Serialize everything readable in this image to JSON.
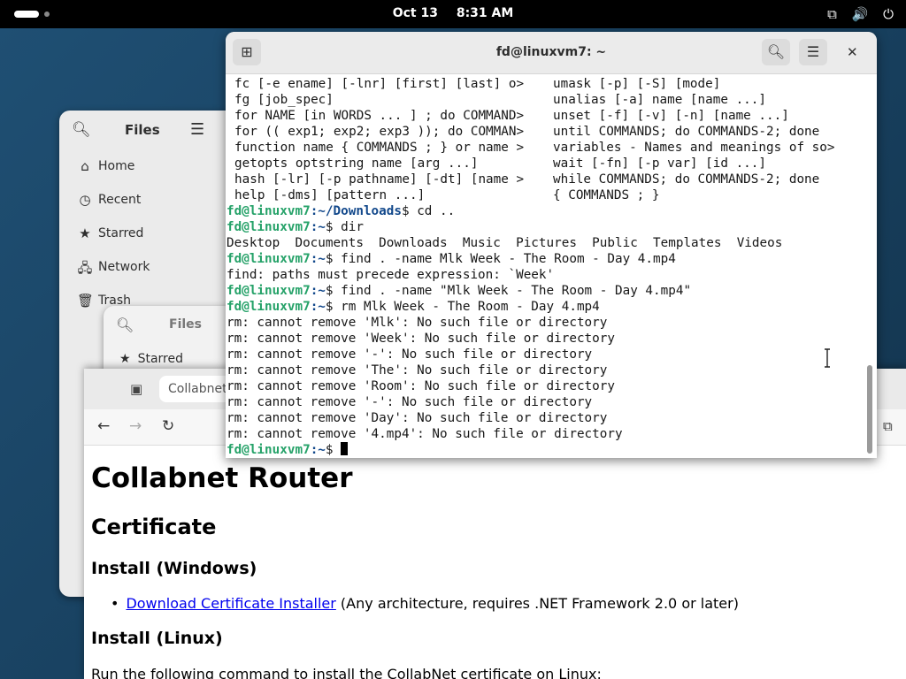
{
  "topbar": {
    "date": "Oct 13",
    "time": "8:31 AM"
  },
  "files_window": {
    "title": "Files",
    "sidebar": [
      {
        "label": "Home",
        "icon": "home-icon",
        "glyph": "⌂"
      },
      {
        "label": "Recent",
        "icon": "clock-icon",
        "glyph": "◷"
      },
      {
        "label": "Starred",
        "icon": "star-icon",
        "glyph": "★"
      },
      {
        "label": "Network",
        "icon": "network-icon",
        "glyph": "🖧"
      },
      {
        "label": "Trash",
        "icon": "trash-icon",
        "glyph": "🗑"
      }
    ]
  },
  "files_window_2": {
    "title": "Files",
    "starred": "Starred"
  },
  "terminal": {
    "title": "fd@linuxvm7: ~",
    "prompt_user": "fd@linuxvm7",
    "help_rows": [
      [
        "fc [-e ename] [-lnr] [first] [last] o>",
        "umask [-p] [-S] [mode]"
      ],
      [
        "fg [job_spec]",
        "unalias [-a] name [name ...]"
      ],
      [
        "for NAME [in WORDS ... ] ; do COMMAND>",
        "unset [-f] [-v] [-n] [name ...]"
      ],
      [
        "for (( exp1; exp2; exp3 )); do COMMAN>",
        "until COMMANDS; do COMMANDS-2; done"
      ],
      [
        "function name { COMMANDS ; } or name >",
        "variables - Names and meanings of so>"
      ],
      [
        "getopts optstring name [arg ...]",
        "wait [-fn] [-p var] [id ...]"
      ],
      [
        "hash [-lr] [-p pathname] [-dt] [name >",
        "while COMMANDS; do COMMANDS-2; done"
      ],
      [
        "help [-dms] [pattern ...]",
        "{ COMMANDS ; }"
      ]
    ],
    "session": [
      {
        "type": "prompt",
        "path": ":~/Downloads",
        "cmd": "$ cd .."
      },
      {
        "type": "prompt",
        "path": ":~",
        "cmd": "$ dir"
      },
      {
        "type": "out",
        "text": "Desktop  Documents  Downloads  Music  Pictures  Public  Templates  Videos"
      },
      {
        "type": "prompt",
        "path": ":~",
        "cmd": "$ find . -name Mlk Week - The Room - Day 4.mp4"
      },
      {
        "type": "out",
        "text": "find: paths must precede expression: `Week'"
      },
      {
        "type": "prompt",
        "path": ":~",
        "cmd": "$ find . -name \"Mlk Week - The Room - Day 4.mp4\""
      },
      {
        "type": "prompt",
        "path": ":~",
        "cmd": "$ rm Mlk Week - The Room - Day 4.mp4"
      },
      {
        "type": "out",
        "text": "rm: cannot remove 'Mlk': No such file or directory"
      },
      {
        "type": "out",
        "text": "rm: cannot remove 'Week': No such file or directory"
      },
      {
        "type": "out",
        "text": "rm: cannot remove '-': No such file or directory"
      },
      {
        "type": "out",
        "text": "rm: cannot remove 'The': No such file or directory"
      },
      {
        "type": "out",
        "text": "rm: cannot remove 'Room': No such file or directory"
      },
      {
        "type": "out",
        "text": "rm: cannot remove '-': No such file or directory"
      },
      {
        "type": "out",
        "text": "rm: cannot remove 'Day': No such file or directory"
      },
      {
        "type": "out",
        "text": "rm: cannot remove '4.mp4': No such file or directory"
      },
      {
        "type": "prompt",
        "path": ":~",
        "cmd": "$ ",
        "cursor": true
      }
    ]
  },
  "browser": {
    "tab_title": "Collabnet",
    "page": {
      "h1": "Collabnet Router",
      "h2": "Certificate",
      "install_windows": "Install (Windows)",
      "download_link": "Download Certificate Installer",
      "download_note": " (Any architecture, requires .NET Framework 2.0 or later)",
      "install_linux": "Install (Linux)",
      "linux_text": "Run the following command to install the CollabNet certificate on Linux:"
    }
  },
  "colors": {
    "prompt_user": "#26a269",
    "prompt_path": "#12488b",
    "link": "#0000ee"
  }
}
